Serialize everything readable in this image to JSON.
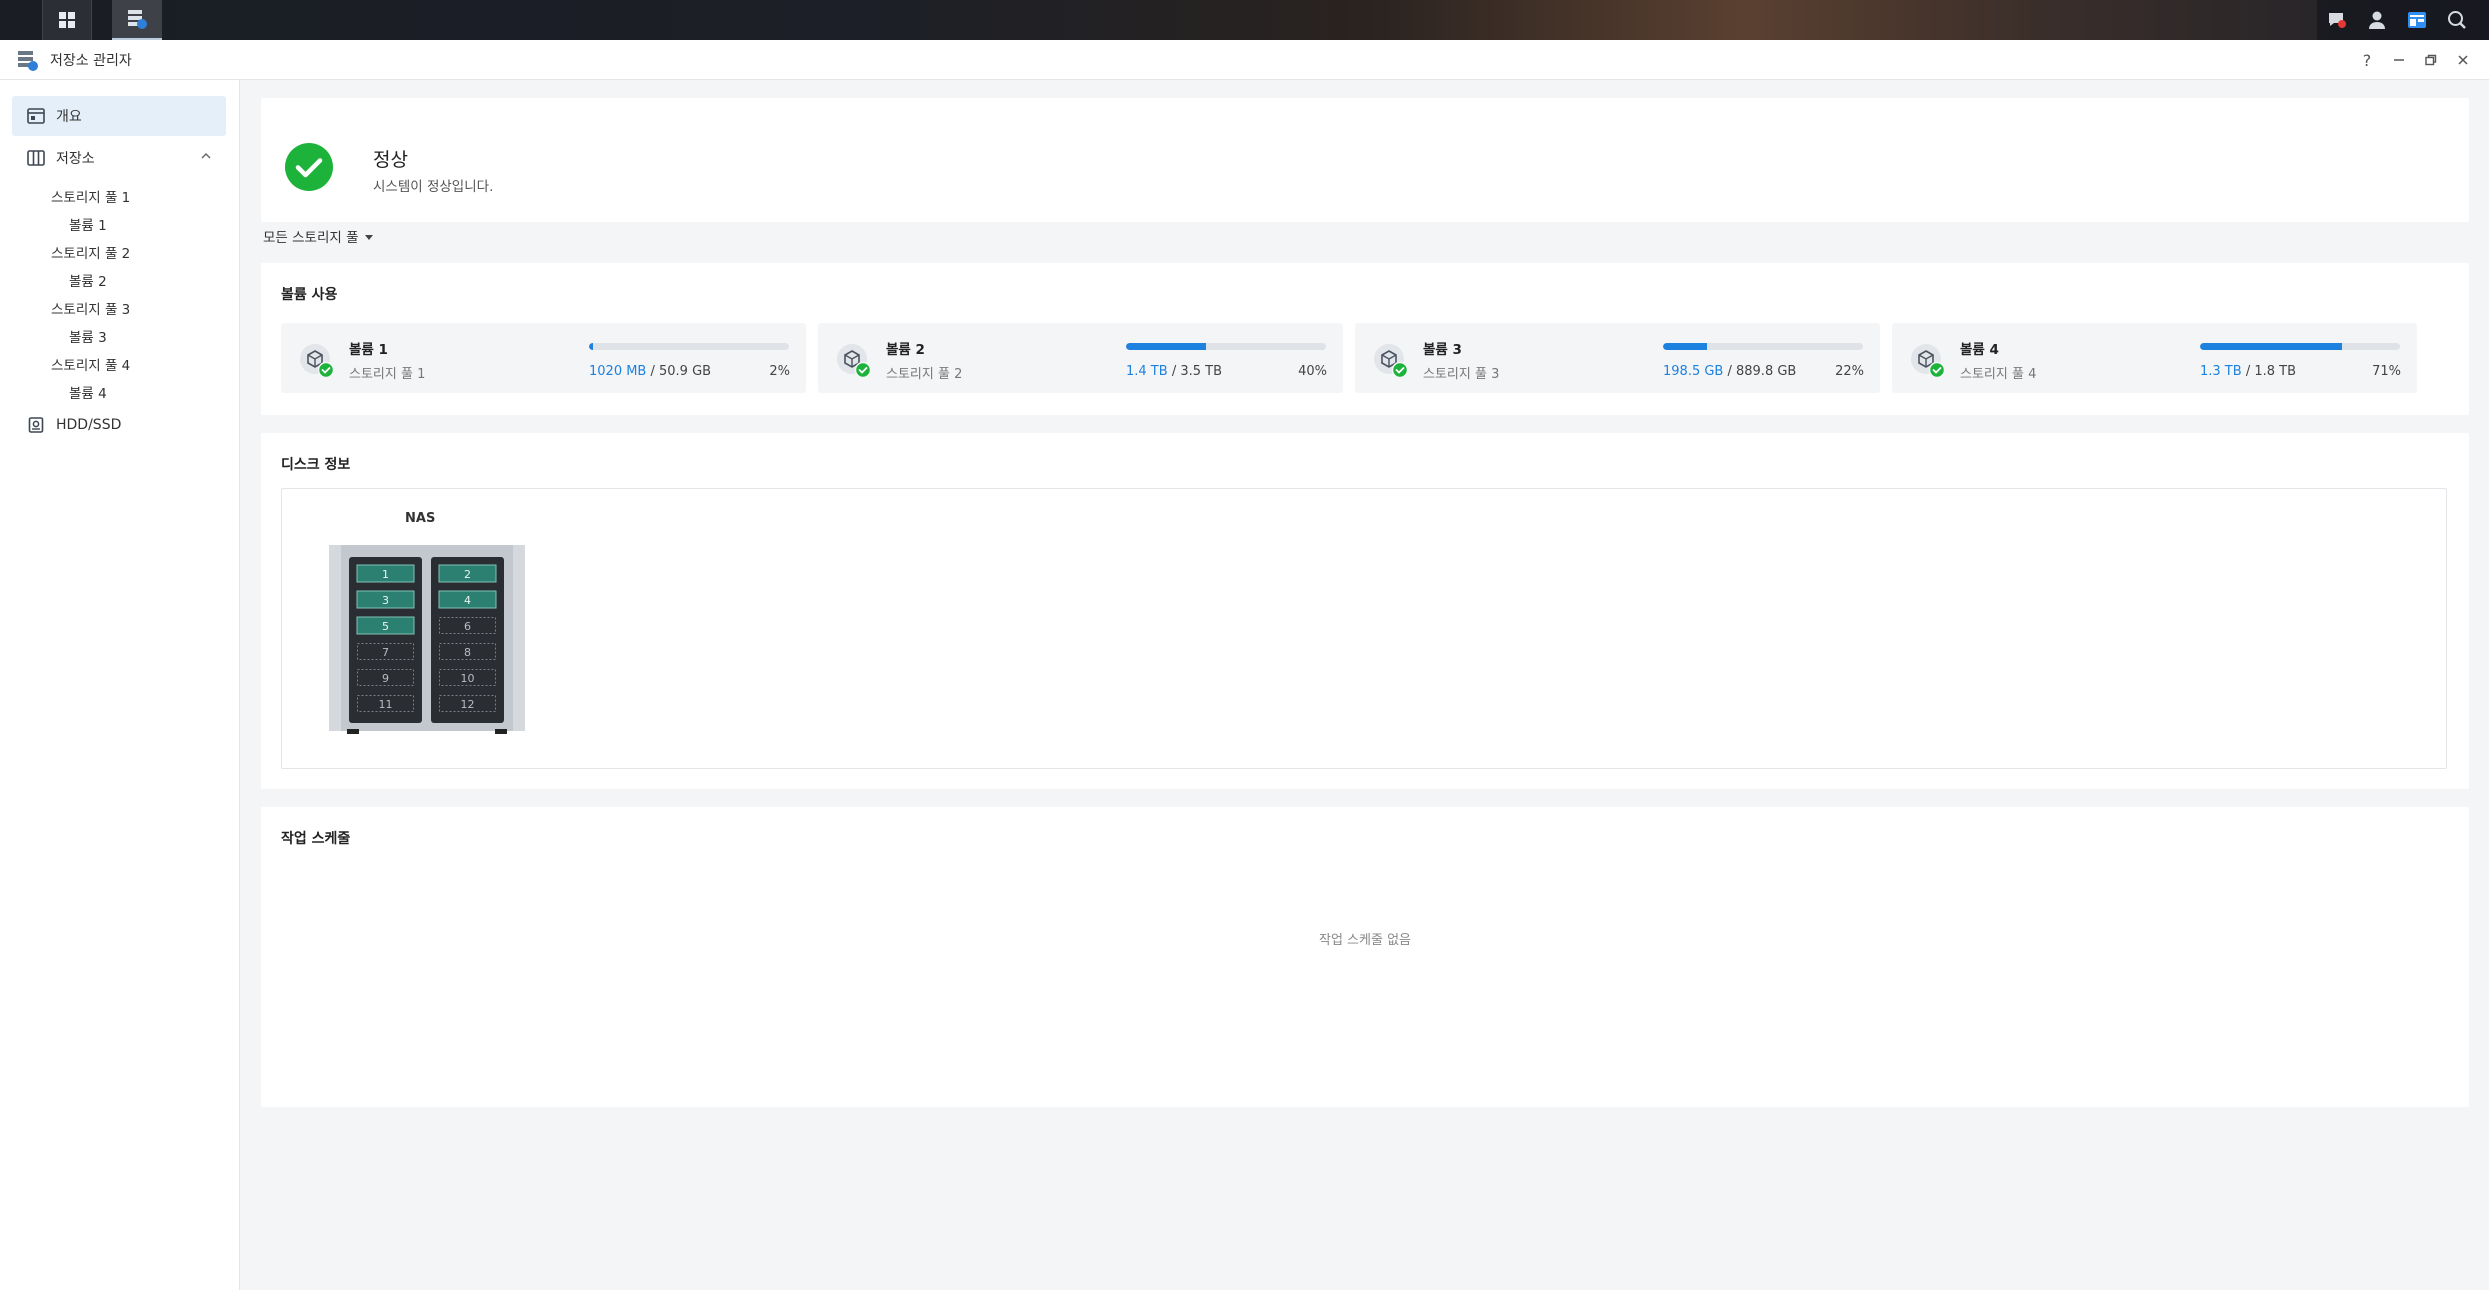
{
  "window": {
    "title": "저장소 관리자",
    "help_label": "?"
  },
  "sidebar": {
    "overview": "개요",
    "storage": "저장소",
    "pools": [
      {
        "label": "스토리지 풀 1",
        "volume": "볼륨 1"
      },
      {
        "label": "스토리지 풀 2",
        "volume": "볼륨 2"
      },
      {
        "label": "스토리지 풀 3",
        "volume": "볼륨 3"
      },
      {
        "label": "스토리지 풀 4",
        "volume": "볼륨 4"
      }
    ],
    "hdd": "HDD/SSD"
  },
  "status": {
    "title": "정상",
    "subtitle": "시스템이 정상입니다.",
    "color": "#1db33b"
  },
  "pool_filter": {
    "selected": "모든 스토리지 풀"
  },
  "volume_usage": {
    "title": "볼륨 사용",
    "accent": "#1d81e0",
    "volumes": [
      {
        "name": "볼륨 1",
        "pool": "스토리지 풀 1",
        "used": "1020 MB",
        "total": "/ 50.9 GB",
        "percent_label": "2%",
        "percent": 2
      },
      {
        "name": "볼륨 2",
        "pool": "스토리지 풀 2",
        "used": "1.4 TB",
        "total": "/ 3.5 TB",
        "percent_label": "40%",
        "percent": 40
      },
      {
        "name": "볼륨 3",
        "pool": "스토리지 풀 3",
        "used": "198.5 GB",
        "total": "/ 889.8 GB",
        "percent_label": "22%",
        "percent": 22
      },
      {
        "name": "볼륨 4",
        "pool": "스토리지 풀 4",
        "used": "1.3 TB",
        "total": "/ 1.8 TB",
        "percent_label": "71%",
        "percent": 71
      }
    ]
  },
  "disk_info": {
    "title": "디스크 정보",
    "device": "NAS",
    "bays": [
      {
        "label": "1",
        "installed": true
      },
      {
        "label": "2",
        "installed": true
      },
      {
        "label": "3",
        "installed": true
      },
      {
        "label": "4",
        "installed": true
      },
      {
        "label": "5",
        "installed": true
      },
      {
        "label": "6",
        "installed": false
      },
      {
        "label": "7",
        "installed": false
      },
      {
        "label": "8",
        "installed": false
      },
      {
        "label": "9",
        "installed": false
      },
      {
        "label": "10",
        "installed": false
      },
      {
        "label": "11",
        "installed": false
      },
      {
        "label": "12",
        "installed": false
      }
    ]
  },
  "schedule": {
    "title": "작업 스케줄",
    "empty": "작업 스케줄 없음"
  }
}
